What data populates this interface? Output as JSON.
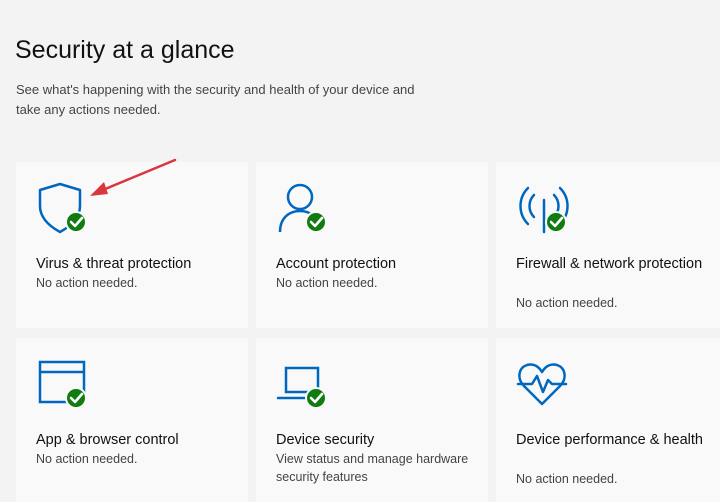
{
  "page": {
    "title": "Security at a glance",
    "description": "See what's happening with the security and health of your device and take any actions needed."
  },
  "colors": {
    "accent": "#0067c0",
    "check": "#107c10",
    "annotation_arrow": "#d9363e"
  },
  "tiles": [
    {
      "title": "Virus & threat protection",
      "status": "No action needed.",
      "icon": "shield-icon"
    },
    {
      "title": "Account protection",
      "status": "No action needed.",
      "icon": "person-icon"
    },
    {
      "title": "Firewall & network protection",
      "status": "No action needed.",
      "icon": "antenna-icon"
    },
    {
      "title": "App & browser control",
      "status": "No action needed.",
      "icon": "browser-window-icon"
    },
    {
      "title": "Device security",
      "status": "View status and manage hardware security features",
      "icon": "laptop-icon"
    },
    {
      "title": "Device performance & health",
      "status": "No action needed.",
      "icon": "heart-pulse-icon"
    }
  ]
}
